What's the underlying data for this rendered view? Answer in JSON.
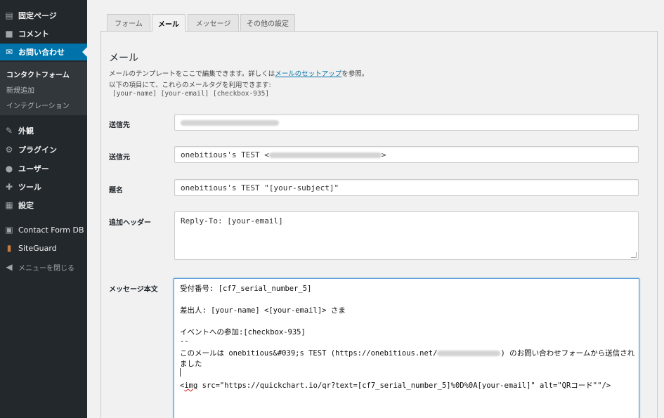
{
  "sidebar": {
    "top": [
      {
        "icon": "pages-icon",
        "glyph": "▤",
        "label": "固定ページ"
      },
      {
        "icon": "comments-icon",
        "glyph": "■",
        "label": "コメント"
      },
      {
        "icon": "mail-icon",
        "glyph": "✉",
        "label": "お問い合わせ"
      }
    ],
    "submenu": [
      "コンタクトフォーム",
      "新規追加",
      "インテグレーション"
    ],
    "bottom": [
      {
        "icon": "appearance-icon",
        "glyph": "✎",
        "label": "外観"
      },
      {
        "icon": "plugins-icon",
        "glyph": "⚙",
        "label": "プラグイン"
      },
      {
        "icon": "users-icon",
        "glyph": "●",
        "label": "ユーザー"
      },
      {
        "icon": "tools-icon",
        "glyph": "✚",
        "label": "ツール"
      },
      {
        "icon": "settings-icon",
        "glyph": "▦",
        "label": "設定"
      },
      {
        "icon": "database-icon",
        "glyph": "▣",
        "label": "Contact Form DB"
      },
      {
        "icon": "siteguard-icon",
        "glyph": "▮",
        "label": "SiteGuard"
      }
    ],
    "collapse": {
      "icon": "collapse-icon",
      "glyph": "◀",
      "label": "メニューを閉じる"
    }
  },
  "tabs": [
    "フォーム",
    "メール",
    "メッセージ",
    "その他の設定"
  ],
  "mail": {
    "heading": "メール",
    "desc_1_pre": "メールのテンプレートをここで編集できます。詳しくは",
    "desc_1_link": "メールのセットアップ",
    "desc_1_post": "を参照。",
    "desc_2": "以下の項目にて、これらのメールタグを利用できます:",
    "tags": "[your-name] [your-email] [checkbox-935]",
    "to_label": "送信先",
    "from_label": "送信元",
    "from_value_pre": "onebitious's TEST <",
    "from_value_post": ">",
    "subject_label": "題名",
    "subject_value": "onebitious's TEST \"[your-subject]\"",
    "headers_label": "追加ヘッダー",
    "headers_value": "Reply-To: [your-email]",
    "body_label": "メッセージ本文",
    "body_line_1": "受付番号: [cf7_serial_number_5]",
    "body_line_2": "差出人: [your-name] <[your-email]> さま",
    "body_line_3": "イベントへの参加:[checkbox-935]",
    "body_line_4": "--",
    "body_line_5_pre": "このメールは onebitious&#039;s TEST (https://onebitious.net/",
    "body_line_5_post": ") のお問い合わせフォームから送信され",
    "body_line_6": "ました",
    "body_line_8_tag": "img",
    "body_line_8_pre": "<",
    "body_line_8_rest": " src=\"https://quickchart.io/qr?text=[cf7_serial_number_5]%0D%0A[your-email]\" alt=\"QRコード\"\"/>"
  },
  "colors": {
    "sidebar_bg": "#23282d",
    "active_bg": "#0073aa",
    "link": "#0073aa",
    "focus_border": "#5b9dd9"
  }
}
